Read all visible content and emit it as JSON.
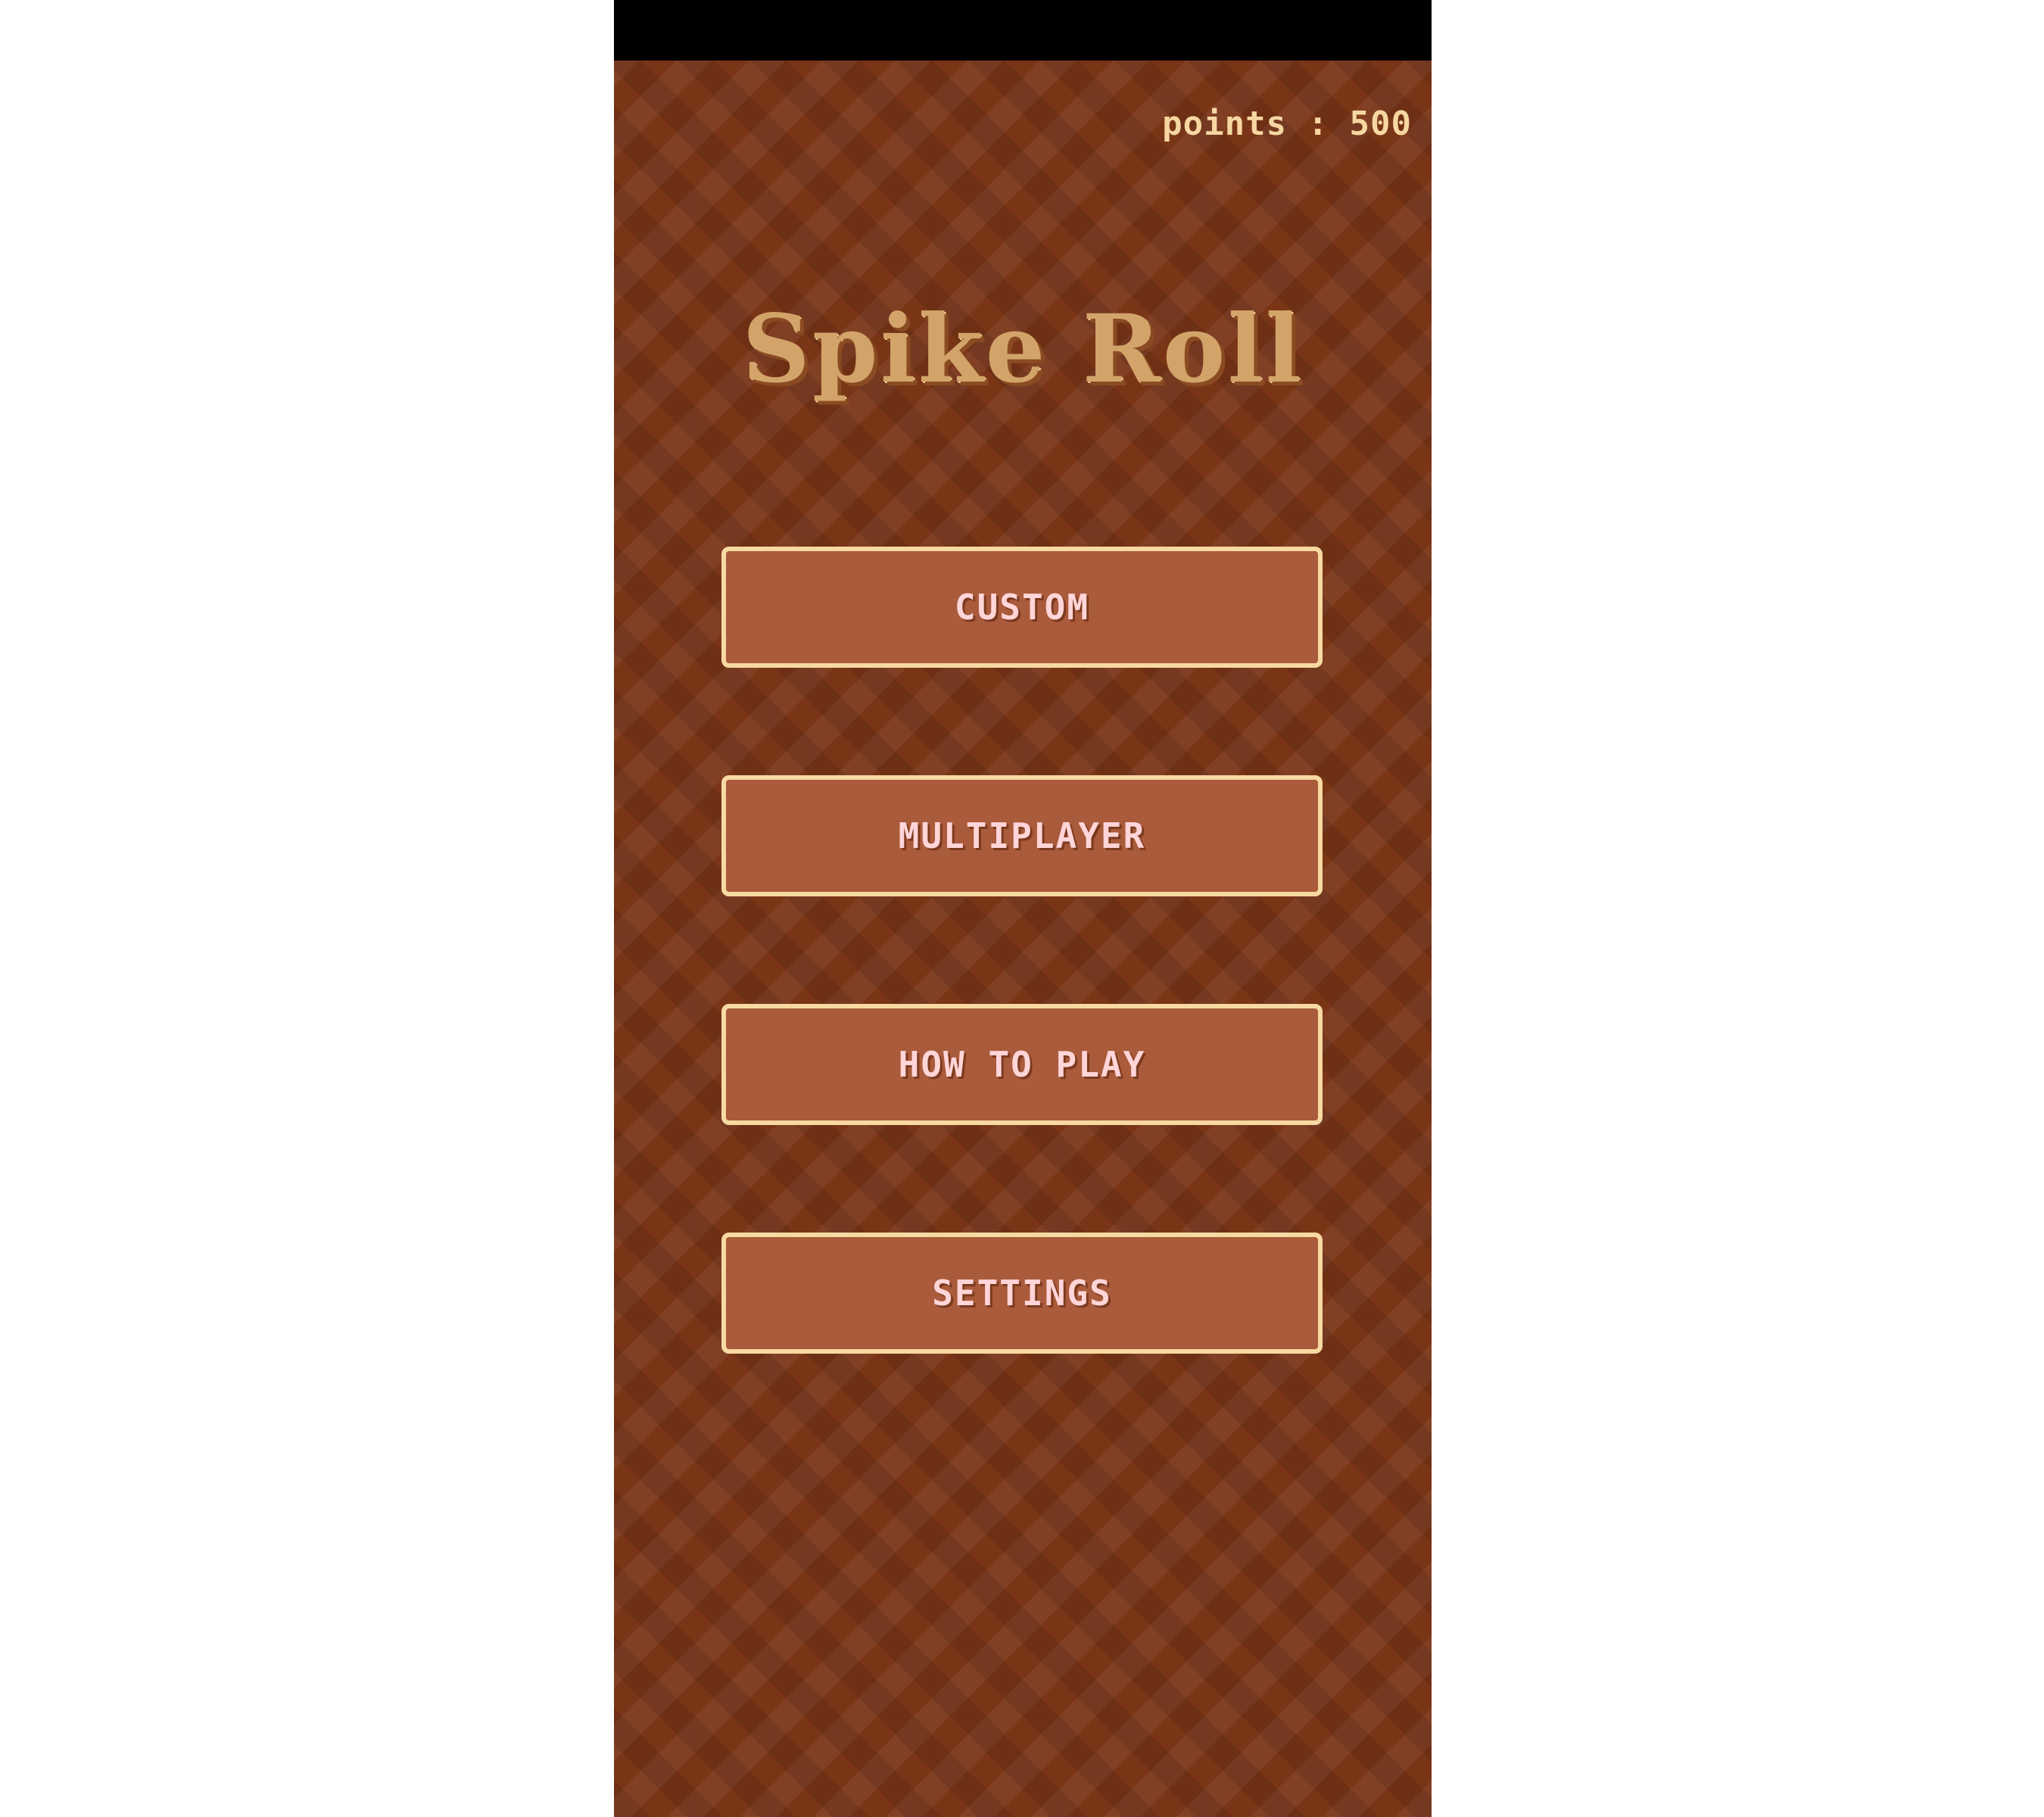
{
  "hud": {
    "points_label": "points : 500"
  },
  "title": "Spike Roll",
  "menu": {
    "custom": "CUSTOM",
    "multiplayer": "MULTIPLAYER",
    "how_to_play": "HOW TO PLAY",
    "settings": "SETTINGS"
  },
  "colors": {
    "background": "#7a3517",
    "button_fill": "#aa5b3b",
    "button_border": "#f7d9a2",
    "title": "#d3a46a",
    "button_text": "#ffd5d8",
    "points_text": "#f6d7a2"
  }
}
